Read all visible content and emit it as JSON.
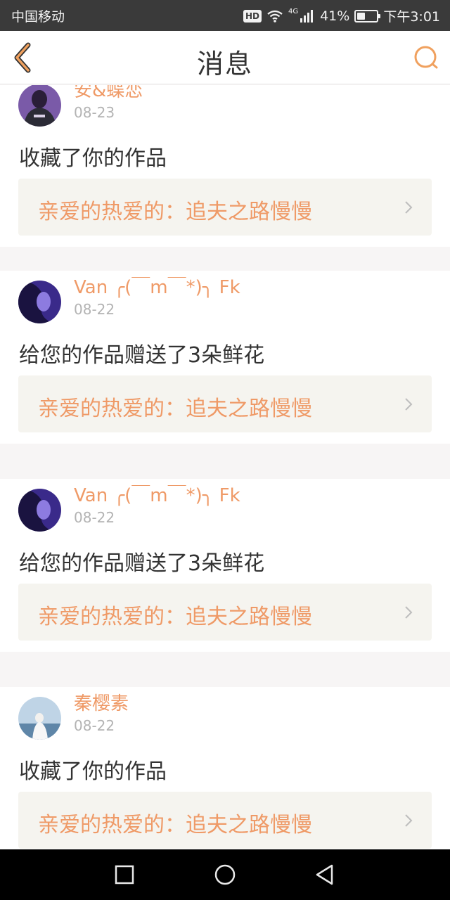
{
  "status_bar": {
    "carrier": "中国移动",
    "hd_label": "HD",
    "network_type": "4G",
    "battery_percent": "41%",
    "battery_level": 0.41,
    "time": "下午3:01"
  },
  "header": {
    "title": "消息",
    "back_icon": "chevron-left-icon",
    "search_icon": "search-icon",
    "accent_color": "#f0a15f"
  },
  "messages": [
    {
      "user": "安&蝶恋",
      "date": "08-23",
      "action": "收藏了你的作品",
      "work": "亲爱的热爱的：追夫之路慢慢"
    },
    {
      "user": "Van ╭(￣m￣*)╮ Fk",
      "date": "08-22",
      "action": "给您的作品赠送了3朵鲜花",
      "work": "亲爱的热爱的：追夫之路慢慢"
    },
    {
      "user": "Van ╭(￣m￣*)╮ Fk",
      "date": "08-22",
      "action": "给您的作品赠送了3朵鲜花",
      "work": "亲爱的热爱的：追夫之路慢慢"
    },
    {
      "user": "秦樱素",
      "date": "08-22",
      "action": "收藏了你的作品",
      "work": "亲爱的热爱的：追夫之路慢慢"
    }
  ],
  "colors": {
    "name_accent": "#ef9a67",
    "work_box_bg": "#f5f4ef",
    "date_gray": "#b3b3b3"
  },
  "nav_bar": {
    "icons": [
      "square-recent-icon",
      "circle-home-icon",
      "triangle-back-icon"
    ]
  }
}
